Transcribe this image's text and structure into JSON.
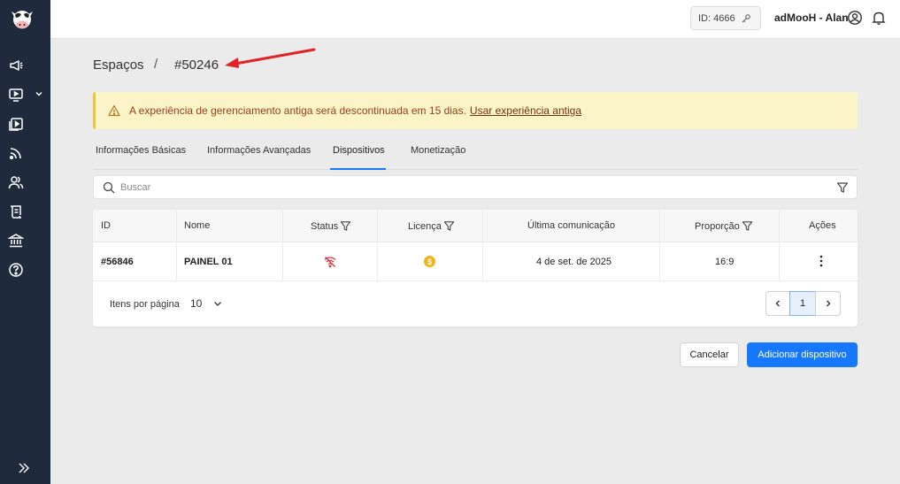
{
  "header": {
    "id_label": "ID: 4666",
    "user_name": "adMooH - Alan"
  },
  "breadcrumb": {
    "section": "Espaços",
    "separator": "/",
    "current": "#50246"
  },
  "alert": {
    "message": "A experiência de gerenciamento antiga será descontinuada em 15 dias.",
    "link": "Usar experiência antiga",
    "color": "#9a3d15"
  },
  "tabs": [
    {
      "label": "Informações Básicas"
    },
    {
      "label": "Informações Avançadas"
    },
    {
      "label": "Dispositivos"
    },
    {
      "label": "Monetização"
    }
  ],
  "active_tab": "Dispositivos",
  "search": {
    "placeholder": "Buscar",
    "value": ""
  },
  "table": {
    "columns": [
      "ID",
      "Nome",
      "Status",
      "Licença",
      "Última comunicação",
      "Proporção",
      "Ações"
    ],
    "rows": [
      {
        "id": "#56846",
        "name": "PAINEL 01",
        "status_icon": "wifi-off-icon",
        "license_icon": "coin-icon",
        "last_communication": "4 de set. de 2025",
        "ratio": "16:9"
      }
    ]
  },
  "pagination": {
    "items_per_page_label": "Itens por página",
    "items_per_page": "10",
    "current_page": "1"
  },
  "actions": {
    "cancel": "Cancelar",
    "add": "Adicionar dispositivo"
  },
  "colors": {
    "sidebar": "#1f2a3d",
    "primary": "#1677ff",
    "alert_bg": "#fbf4c8",
    "status_red": "#d9363e",
    "license_gold": "#f0b418",
    "annotation_arrow": "#e02424"
  }
}
